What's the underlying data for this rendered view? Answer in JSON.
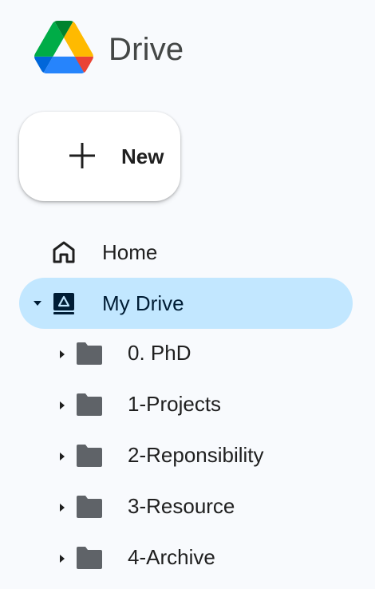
{
  "header": {
    "logo_icon": "google-drive-logo",
    "app_name": "Drive"
  },
  "new_button": {
    "icon": "plus-icon",
    "label": "New"
  },
  "nav": {
    "home": {
      "icon": "home-icon",
      "label": "Home"
    },
    "my_drive": {
      "icon": "my-drive-icon",
      "label": "My Drive",
      "expanded": true,
      "active": true
    }
  },
  "folders": [
    {
      "icon": "folder-icon",
      "label": "0. PhD"
    },
    {
      "icon": "folder-icon",
      "label": "1-Projects"
    },
    {
      "icon": "folder-icon",
      "label": "2-Reponsibility"
    },
    {
      "icon": "folder-icon",
      "label": "3-Resource"
    },
    {
      "icon": "folder-icon",
      "label": "4-Archive"
    }
  ],
  "colors": {
    "background": "#f8fafd",
    "active_bg": "#c2e7ff",
    "folder": "#5f6368",
    "text": "#1f1f1f"
  }
}
